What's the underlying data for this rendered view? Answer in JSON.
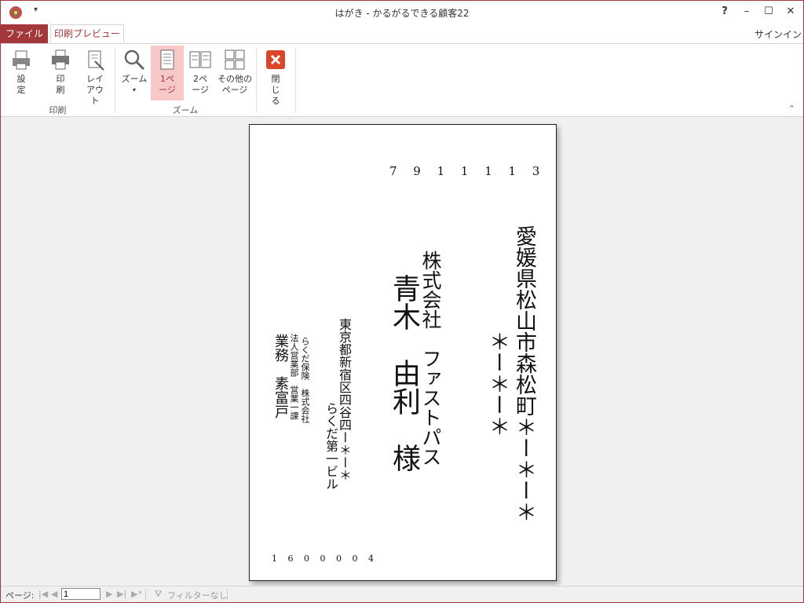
{
  "window": {
    "title": "はがき - かるがるできる顧客22",
    "qat_label": "▾",
    "help": "?",
    "minimize": "–",
    "maximize": "☐",
    "close": "✕"
  },
  "tabs": {
    "file": "ファイル",
    "print_preview": "印刷プレビュー",
    "signin": "サインイン"
  },
  "ribbon": {
    "buttons": {
      "setup": "設定",
      "print": "印刷",
      "layout": "レイアウト",
      "zoom": "ズーム",
      "one_page": "1ページ",
      "two_pages": "2ページ",
      "more_pages": "その他のページ",
      "close": "閉じる"
    },
    "groups": {
      "print": "印刷",
      "zoom": "ズーム"
    },
    "accent": "#a4373a",
    "active_bg": "#f8c8c8"
  },
  "postcard": {
    "recipient_zip": "7 9 1 1 1 1 3",
    "recipient_address_1": "愛媛県松山市森松町＊ー＊ー＊",
    "recipient_address_2": "＊ー＊ー＊",
    "recipient_company": "株式会社　ファストパス",
    "recipient_name": "青木　由利　様",
    "sender_address_1": "東京都新宿区四谷四ー＊ー＊",
    "sender_address_2": "らくだ第一ビル",
    "sender_company_1": "らくだ保険　株式会社",
    "sender_company_2": "法人営業部　営業一課",
    "sender_name": "業務　素富戸",
    "sender_zip": "1 6 0 0 0 0 4"
  },
  "statusbar": {
    "page_label": "ページ:",
    "page_value": "1",
    "filter": "フィルターなし"
  }
}
